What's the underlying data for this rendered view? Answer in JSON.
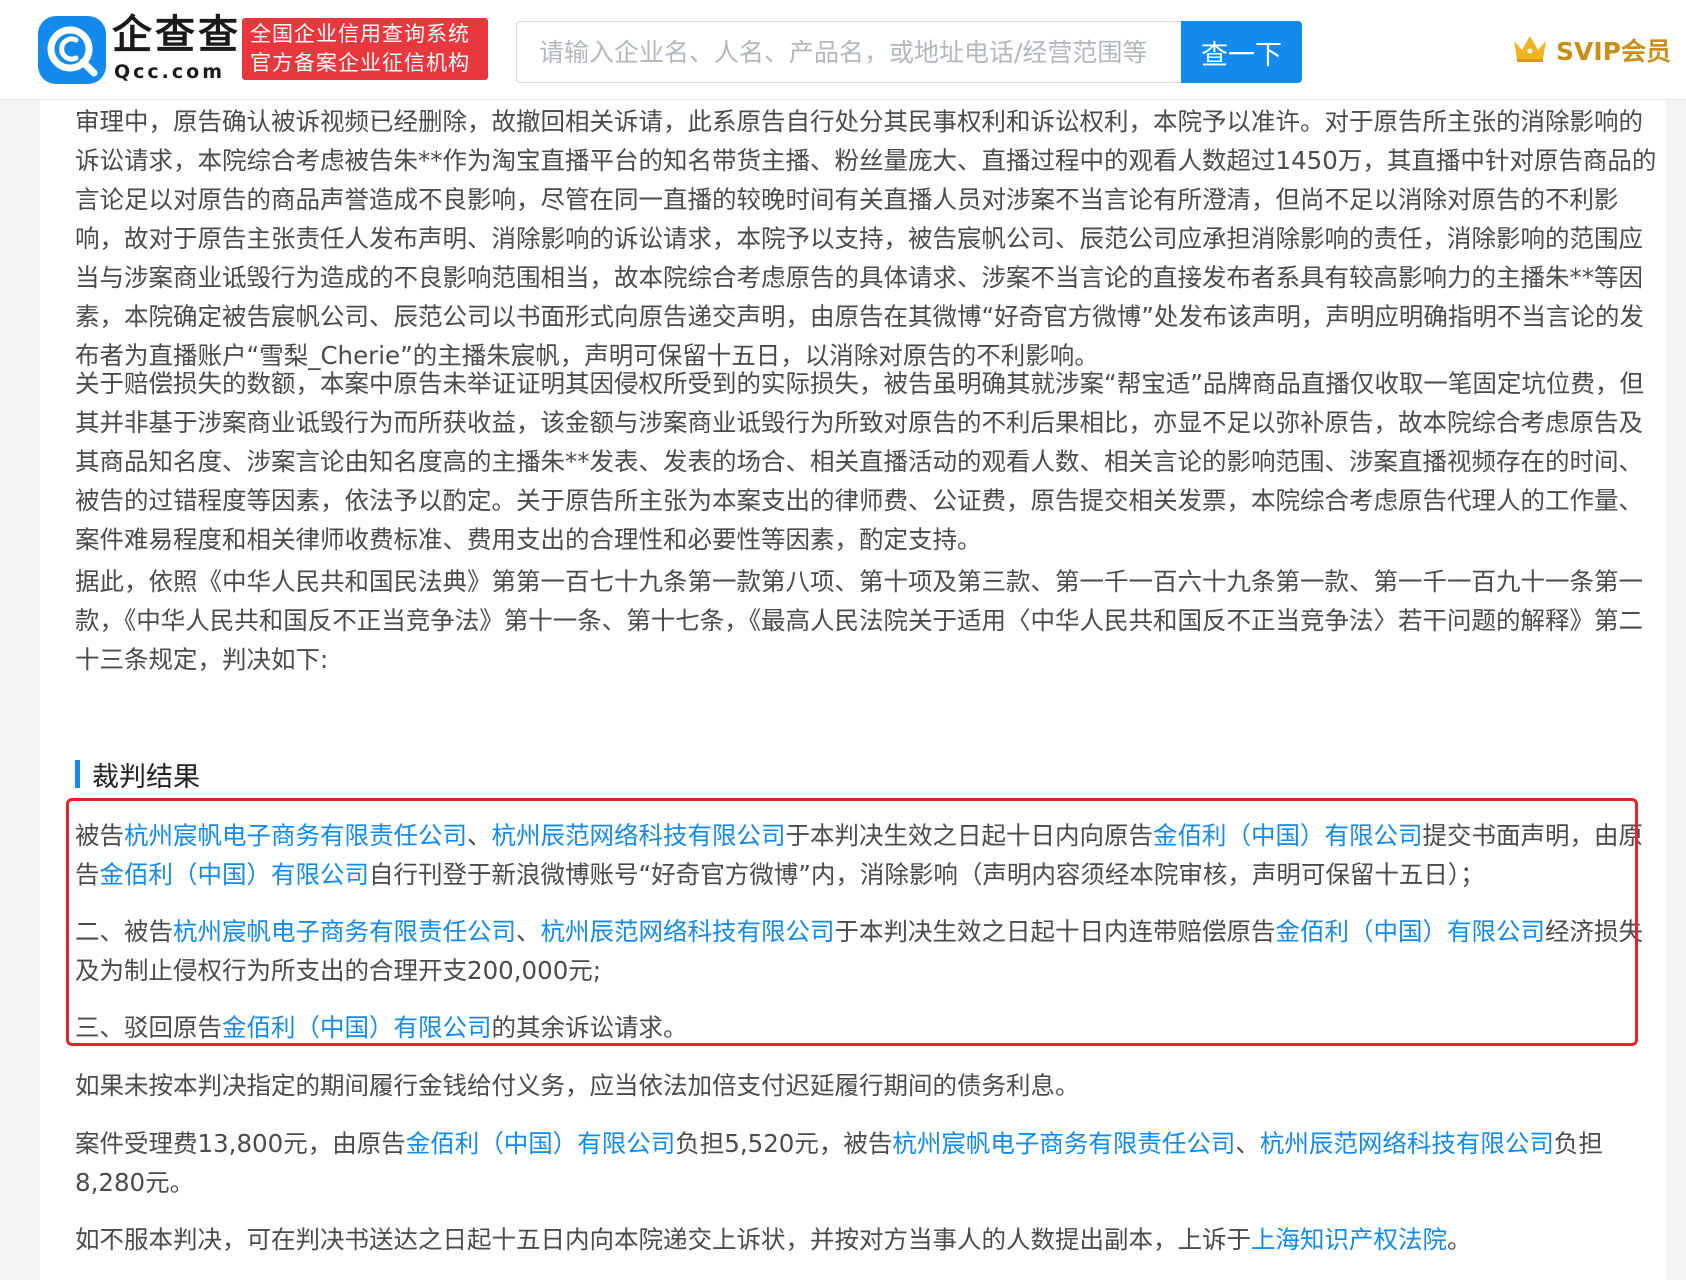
{
  "header": {
    "logo_name": "企查查",
    "logo_domain": "Qcc.com",
    "badge_line1": "全国企业信用查询系统",
    "badge_line2": "官方备案企业征信机构",
    "search_placeholder": "请输入企业名、人名、产品名，或地址电话/经营范围等",
    "search_value": "",
    "search_button": "查一下",
    "svip_label": "SVIP会员",
    "colors": {
      "brand": "#128bed",
      "badge": "#e8383d",
      "svip": "#c8901a"
    }
  },
  "content": {
    "p1": "审理中，原告确认被诉视频已经删除，故撤回相关诉请，此系原告自行处分其民事权利和诉讼权利，本院予以准许。对于原告所主张的消除影响的诉讼请求，本院综合考虑被告朱**作为淘宝直播平台的知名带货主播、粉丝量庞大、直播过程中的观看人数超过1450万，其直播中针对原告商品的言论足以对原告的商品声誉造成不良影响，尽管在同一直播的较晚时间有关直播人员对涉案不当言论有所澄清，但尚不足以消除对原告的不利影响，故对于原告主张责任人发布声明、消除影响的诉讼请求，本院予以支持，被告宸帆公司、辰范公司应承担消除影响的责任，消除影响的范围应当与涉案商业诋毁行为造成的不良影响范围相当，故本院综合考虑原告的具体请求、涉案不当言论的直接发布者系具有较高影响力的主播朱**等因素，本院确定被告宸帆公司、辰范公司以书面形式向原告递交声明，由原告在其微博“好奇官方微博”处发布该声明，声明应明确指明不当言论的发布者为直播账户“雪梨_Cherie”的主播朱宸帆，声明可保留十五日，以消除对原告的不利影响。",
    "p2": "关于赔偿损失的数额，本案中原告未举证证明其因侵权所受到的实际损失，被告虽明确其就涉案“帮宝适”品牌商品直播仅收取一笔固定坑位费，但其并非基于涉案商业诋毁行为而所获收益，该金额与涉案商业诋毁行为所致对原告的不利后果相比，亦显不足以弥补原告，故本院综合考虑原告及其商品知名度、涉案言论由知名度高的主播朱**发表、发表的场合、相关直播活动的观看人数、相关言论的影响范围、涉案直播视频存在的时间、被告的过错程度等因素，依法予以酌定。关于原告所主张为本案支出的律师费、公证费，原告提交相关发票，本院综合考虑原告代理人的工作量、案件难易程度和相关律师收费标准、费用支出的合理性和必要性等因素，酌定支持。",
    "p3": "据此，依照《中华人民共和国民法典》第第一百七十九条第一款第八项、第十项及第三款、第一千一百六十九条第一款、第一千一百九十一条第一款，《中华人民共和国反不正当竞争法》第十一条、第十七条，《最高人民法院关于适用〈中华人民共和国反不正当竞争法〉若干问题的解释》第二十三条规定，判决如下:",
    "section_title": "裁判结果",
    "v1": {
      "t1": "被告",
      "link1": "杭州宸帆电子商务有限责任公司",
      "sep": "、",
      "link2": "杭州辰范网络科技有限公司",
      "t2": "于本判决生效之日起十日内向原告",
      "link3": "金佰利（中国）有限公司",
      "t3": "提交书面声明，由原告",
      "link4": "金佰利（中国）有限公司",
      "t4": "自行刊登于新浪微博账号“好奇官方微博”内，消除影响（声明内容须经本院审核，声明可保留十五日）；"
    },
    "v2": {
      "t1": "二、被告",
      "link1": "杭州宸帆电子商务有限责任公司",
      "sep": "、",
      "link2": "杭州辰范网络科技有限公司",
      "t2": "于本判决生效之日起十日内连带赔偿原告",
      "link3": "金佰利（中国）有限公司",
      "t3": "经济损失及为制止侵权行为所支出的合理开支200,000元;"
    },
    "v3": {
      "t1": "三、驳回原告",
      "link1": "金佰利（中国）有限公司",
      "t2": "的其余诉讼请求。"
    },
    "p4": "如果未按本判决指定的期间履行金钱给付义务，应当依法加倍支付迟延履行期间的债务利息。",
    "p5": {
      "t1": "案件受理费13,800元，由原告",
      "link1": "金佰利（中国）有限公司",
      "t2": "负担5,520元，被告",
      "link2": "杭州宸帆电子商务有限责任公司",
      "sep": "、",
      "link3": "杭州辰范网络科技有限公司",
      "t3": "负担8,280元。"
    },
    "p6": {
      "t1": "如不服本判决，可在判决书送达之日起十五日内向本院递交上诉状，并按对方当事人的人数提出副本，上诉于",
      "link1": "上海知识产权法院",
      "t2": "。"
    },
    "colors": {
      "link": "#128bed",
      "highlight_border": "#e8222b",
      "text": "#4b4b4b"
    }
  }
}
